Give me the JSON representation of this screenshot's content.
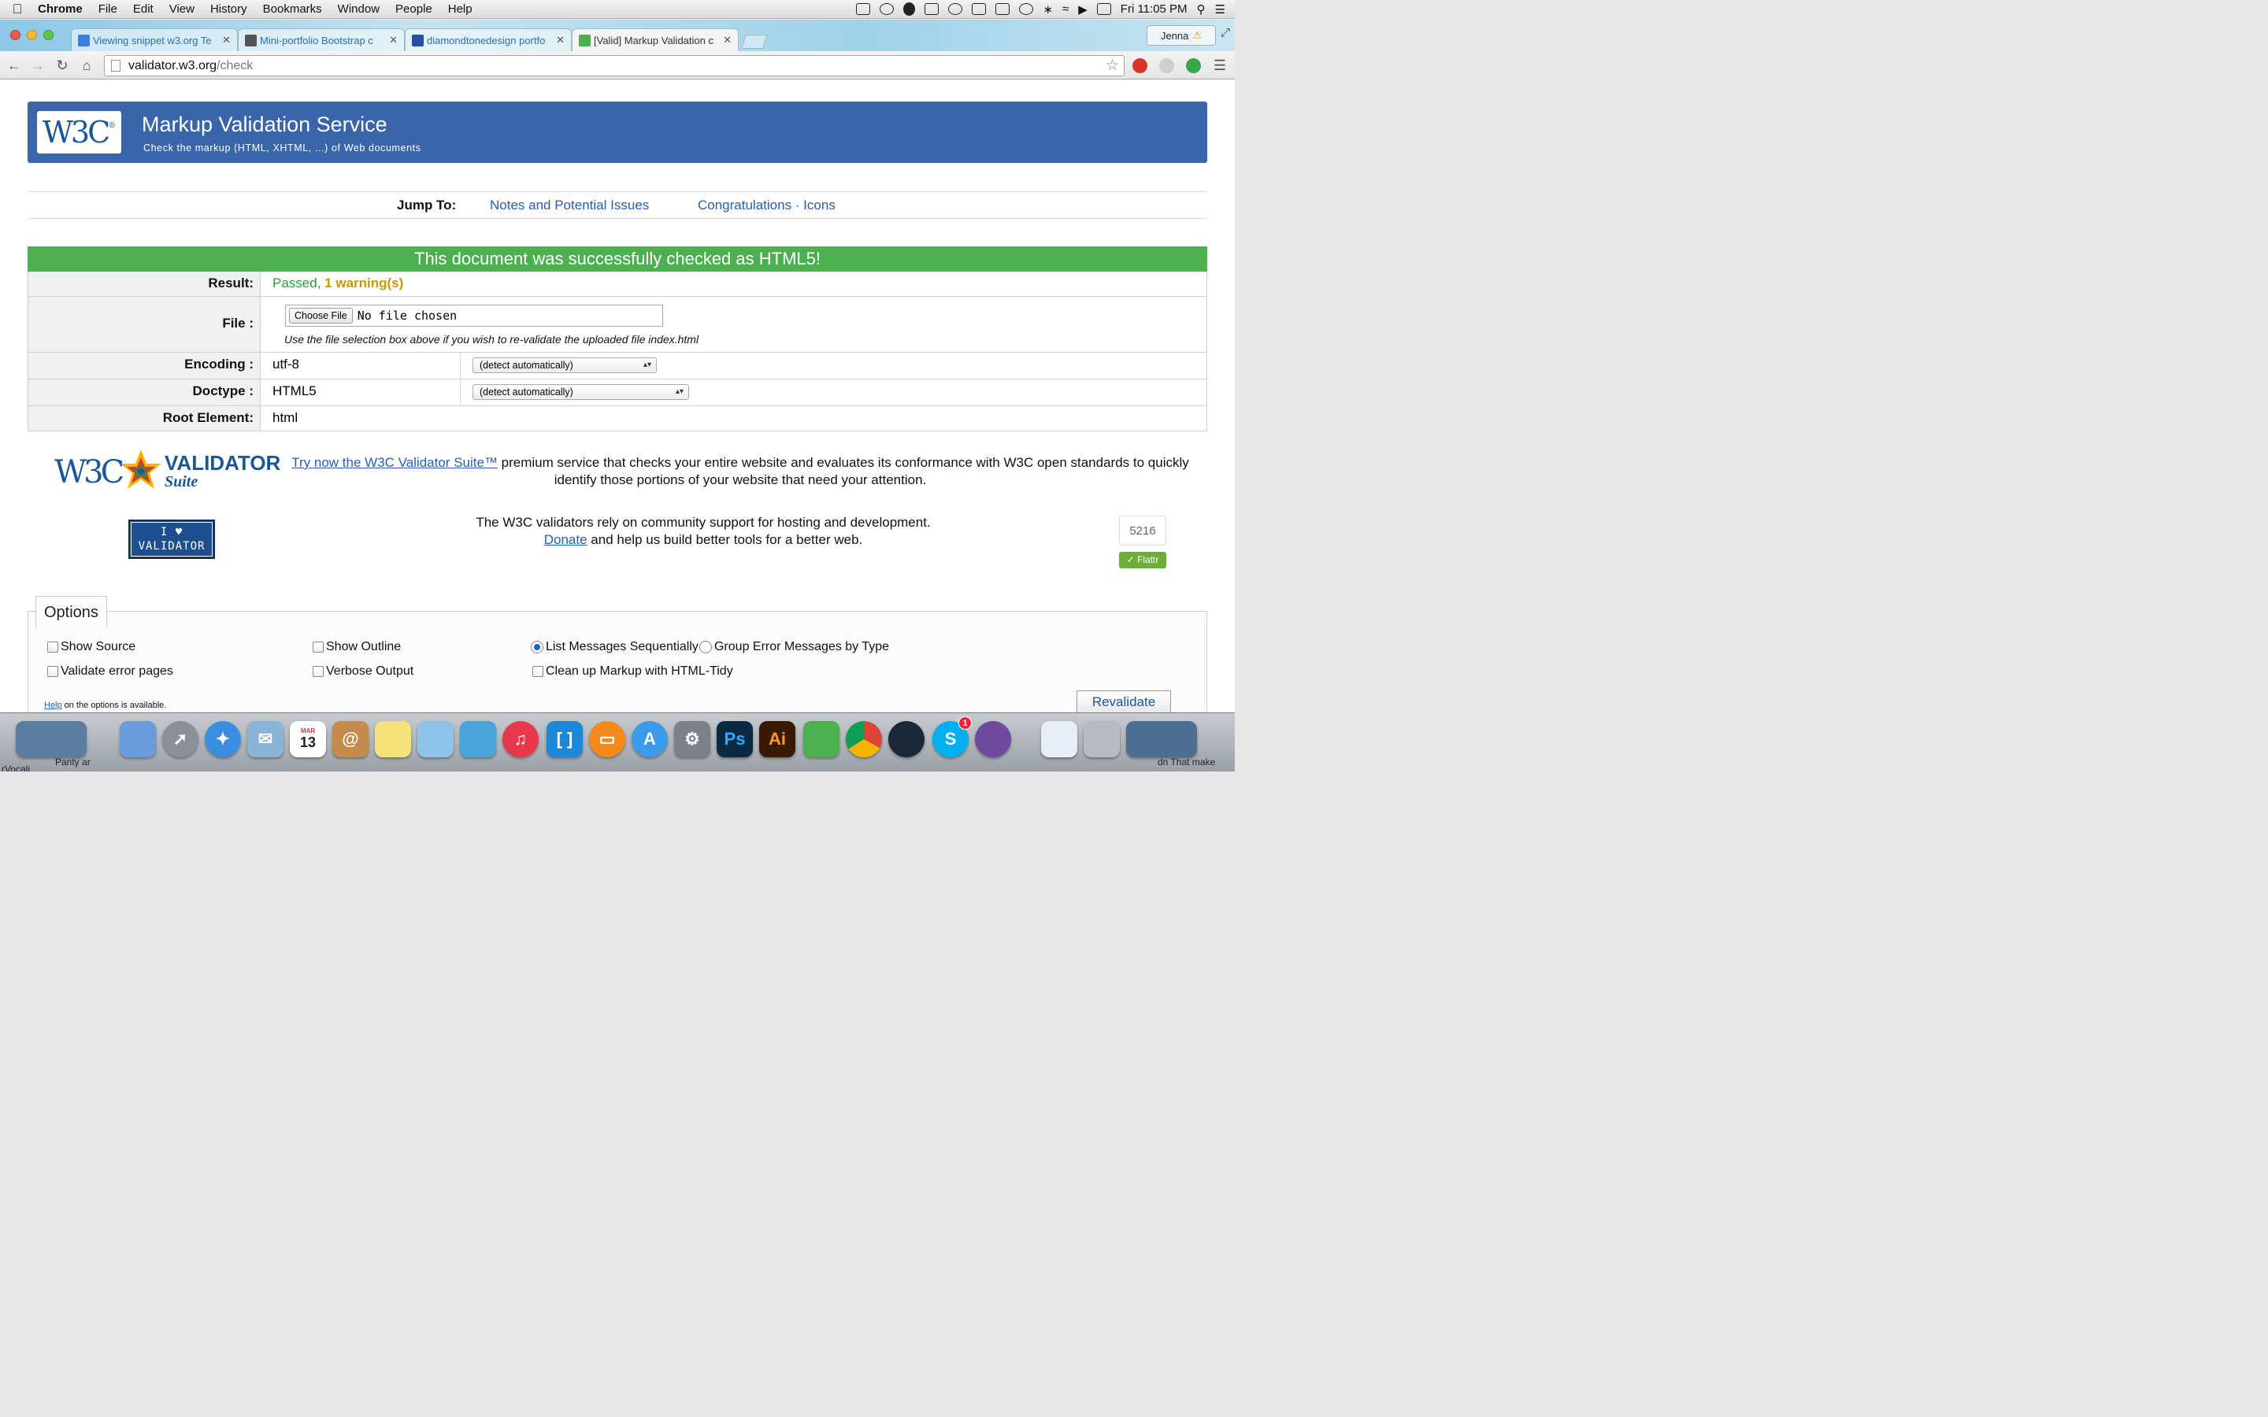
{
  "menubar": {
    "app": "Chrome",
    "items": [
      "File",
      "Edit",
      "View",
      "History",
      "Bookmarks",
      "Window",
      "People",
      "Help"
    ],
    "clock": "Fri 11:05 PM"
  },
  "tabs": [
    {
      "label": "Viewing snippet w3.org Te",
      "favicon_color": "#3b7dd8"
    },
    {
      "label": "Mini-portfolio Bootstrap c",
      "favicon_color": "#555555"
    },
    {
      "label": "diamondtonedesign portfo",
      "favicon_color": "#2350a8"
    },
    {
      "label": "[Valid] Markup Validation c",
      "favicon_color": "#4caf50"
    }
  ],
  "profile": {
    "name": "Jenna",
    "warn_icon": "⚠"
  },
  "address": {
    "host": "validator.w3.org",
    "path": "/check"
  },
  "banner": {
    "logo": "W3C",
    "title": "Markup Validation Service",
    "subtitle": "Check the markup (HTML, XHTML, ...) of Web documents"
  },
  "jump": {
    "label": "Jump To:",
    "link1": "Notes and Potential Issues",
    "link2": "Congratulations · Icons"
  },
  "result": {
    "headline": "This document was successfully checked as HTML5!",
    "result_label": "Result:",
    "passed": "Passed,",
    "warnings": "1 warning(s)",
    "file_label": "File :",
    "choose_file": "Choose File",
    "no_file": "No file chosen",
    "file_hint": "Use the file selection box above if you wish to re-validate the uploaded file index.html",
    "encoding_label": "Encoding :",
    "encoding_value": "utf-8",
    "encoding_select": "(detect automatically)",
    "doctype_label": "Doctype :",
    "doctype_value": "HTML5",
    "doctype_select": "(detect automatically)",
    "root_label": "Root Element:",
    "root_value": "html"
  },
  "suite": {
    "name": "VALIDATOR",
    "sub": "Suite",
    "link": "Try now the W3C Validator Suite™",
    "text": " premium service that checks your entire website and evaluates its conformance with W3C open standards to quickly identify those portions of your website that need your attention."
  },
  "donate": {
    "badge_line1": "I ♥",
    "badge_line2": "VALIDATOR",
    "line1": "The W3C validators rely on community support for hosting and development.",
    "link": "Donate",
    "line2": " and help us build better tools for a better web.",
    "flattr_count": "5216",
    "flattr_label": "Flattr"
  },
  "options": {
    "legend": "Options",
    "show_source": "Show Source",
    "show_outline": "Show Outline",
    "list_sequential": "List Messages Sequentially",
    "group_by_type": "Group Error Messages by Type",
    "validate_error_pages": "Validate error pages",
    "verbose_output": "Verbose Output",
    "cleanup_tidy": "Clean up Markup with HTML-Tidy",
    "help_link": "Help",
    "help_text": " on the options is available.",
    "revalidate": "Revalidate",
    "selected_grouping": "List Messages Sequentially"
  },
  "dock": {
    "calendar_month": "MAR",
    "calendar_day": "13",
    "skype_badge": "1",
    "label_left1": "Panty ar",
    "label_left2": "rVocali",
    "label_right": "dn That make"
  }
}
